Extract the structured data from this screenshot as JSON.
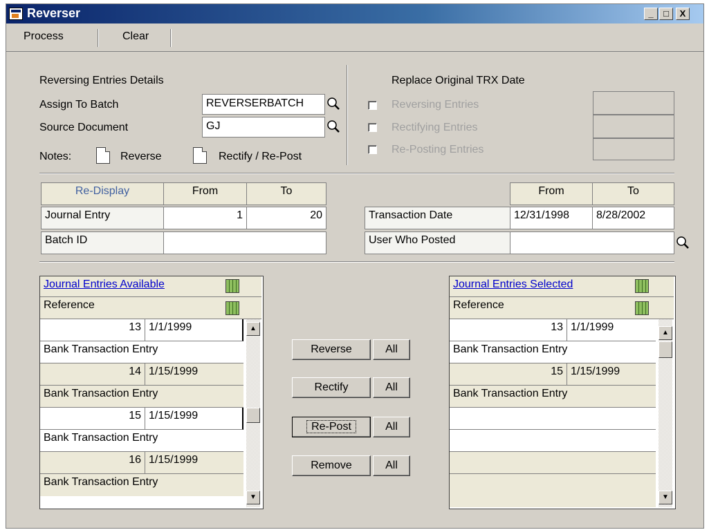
{
  "window": {
    "title": "Reverser",
    "min": "_",
    "max": "□",
    "close": "X"
  },
  "toolbar": {
    "process": "Process",
    "clear": "Clear"
  },
  "details": {
    "heading": "Reversing Entries Details",
    "assign_label": "Assign To Batch",
    "assign_value": "REVERSERBATCH",
    "source_label": "Source Document",
    "source_value": "GJ",
    "notes_label": "Notes:",
    "reverse_note": "Reverse",
    "rectify_note": "Rectify / Re-Post"
  },
  "replace": {
    "heading": "Replace Original TRX Date",
    "reversing": "Reversing Entries",
    "rectifying": "Rectifying Entries",
    "reposting": "Re-Posting Entries"
  },
  "range": {
    "redisplay": "Re-Display",
    "from": "From",
    "to": "To",
    "journal_label": "Journal Entry",
    "journal_from": "1",
    "journal_to": "20",
    "batch_label": "Batch ID",
    "batch_value": "",
    "date_from_hdr": "From",
    "date_to_hdr": "To",
    "trx_label": "Transaction Date",
    "trx_from": "12/31/1998",
    "trx_to": "8/28/2002",
    "user_label": "User Who Posted",
    "user_value": ""
  },
  "available": {
    "title": "Journal Entries Available",
    "reference": "Reference",
    "rows": [
      {
        "num": "13",
        "date": "1/1/1999",
        "desc": "Bank Transaction Entry"
      },
      {
        "num": "14",
        "date": "1/15/1999",
        "desc": "Bank Transaction Entry"
      },
      {
        "num": "15",
        "date": "1/15/1999",
        "desc": "Bank Transaction Entry"
      },
      {
        "num": "16",
        "date": "1/15/1999",
        "desc": "Bank Transaction Entry"
      }
    ]
  },
  "selected": {
    "title": "Journal Entries Selected",
    "reference": "Reference",
    "rows": [
      {
        "num": "13",
        "date": "1/1/1999",
        "desc": "Bank Transaction Entry"
      },
      {
        "num": "15",
        "date": "1/15/1999",
        "desc": "Bank Transaction Entry"
      }
    ]
  },
  "actions": {
    "reverse": "Reverse",
    "rectify": "Rectify",
    "repost": "Re-Post",
    "remove": "Remove",
    "all": "All"
  },
  "icons": {
    "lookup": "magnifier-icon",
    "note": "note-icon",
    "grid": "grid-expand-icon",
    "scroll_up": "▲",
    "scroll_down": "▼"
  }
}
